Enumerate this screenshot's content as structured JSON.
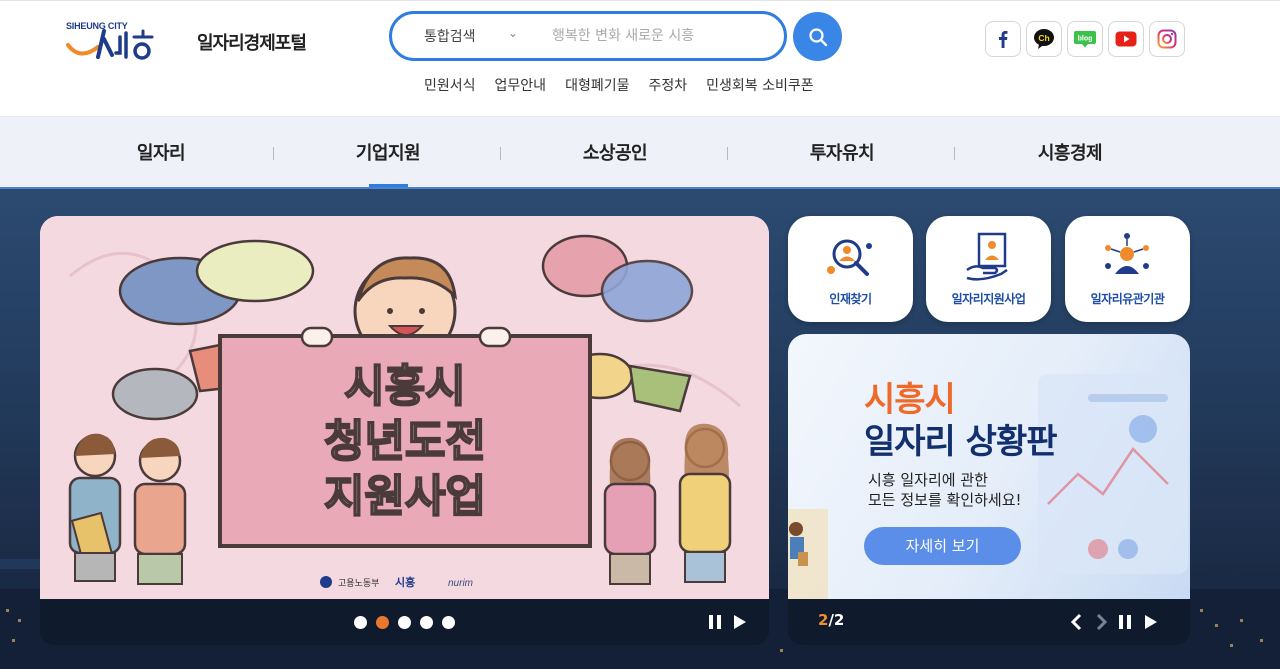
{
  "header": {
    "logo_en": "SIHEUNG CITY",
    "portal_title": "일자리경제포털",
    "search": {
      "selected_scope": "통합검색",
      "placeholder": "행복한 변화 새로운 시흥"
    },
    "quick_links": [
      "민원서식",
      "업무안내",
      "대형폐기물",
      "주정차",
      "민생회복 소비쿠폰"
    ],
    "sns": [
      "facebook-icon",
      "kakao-channel-icon",
      "blog-icon",
      "youtube-icon",
      "instagram-icon"
    ],
    "sns_labels": {
      "kakao": "Ch",
      "blog": "blog"
    }
  },
  "gnb": {
    "items": [
      "일자리",
      "기업지원",
      "소상공인",
      "투자유치",
      "시흥경제"
    ],
    "active_index": 1
  },
  "main_banner": {
    "lines": [
      "시흥시",
      "청년도전",
      "지원사업"
    ],
    "footer_logos": [
      "고용노동부",
      "시흥",
      "nurim"
    ],
    "slide_count": 5,
    "active_slide": 2
  },
  "quick_cards": [
    "인재찾기",
    "일자리지원사업",
    "일자리유관기관"
  ],
  "side_banner": {
    "title_line1": "시흥시",
    "title_line2": "일자리 상황판",
    "desc_line1": "시흥 일자리에 관한",
    "desc_line2": "모든 정보를 확인하세요!",
    "button": "자세히 보기",
    "pager_current": "2",
    "pager_total": "/2"
  },
  "colors": {
    "accent_blue": "#2f7de1",
    "orange": "#e8782e",
    "navy": "#12306e",
    "banner_pink": "#f4d9e1",
    "sign_pink": "#e9a9b7"
  }
}
